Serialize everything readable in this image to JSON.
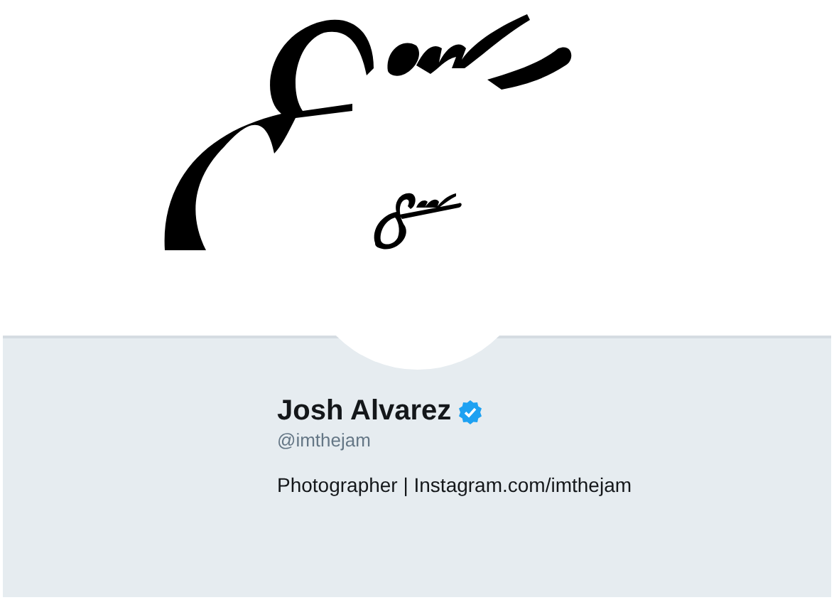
{
  "profile": {
    "name": "Josh Alvarez",
    "verified": true,
    "handle": "@imthejam",
    "bio": "Photographer | Instagram.com/imthejam"
  }
}
